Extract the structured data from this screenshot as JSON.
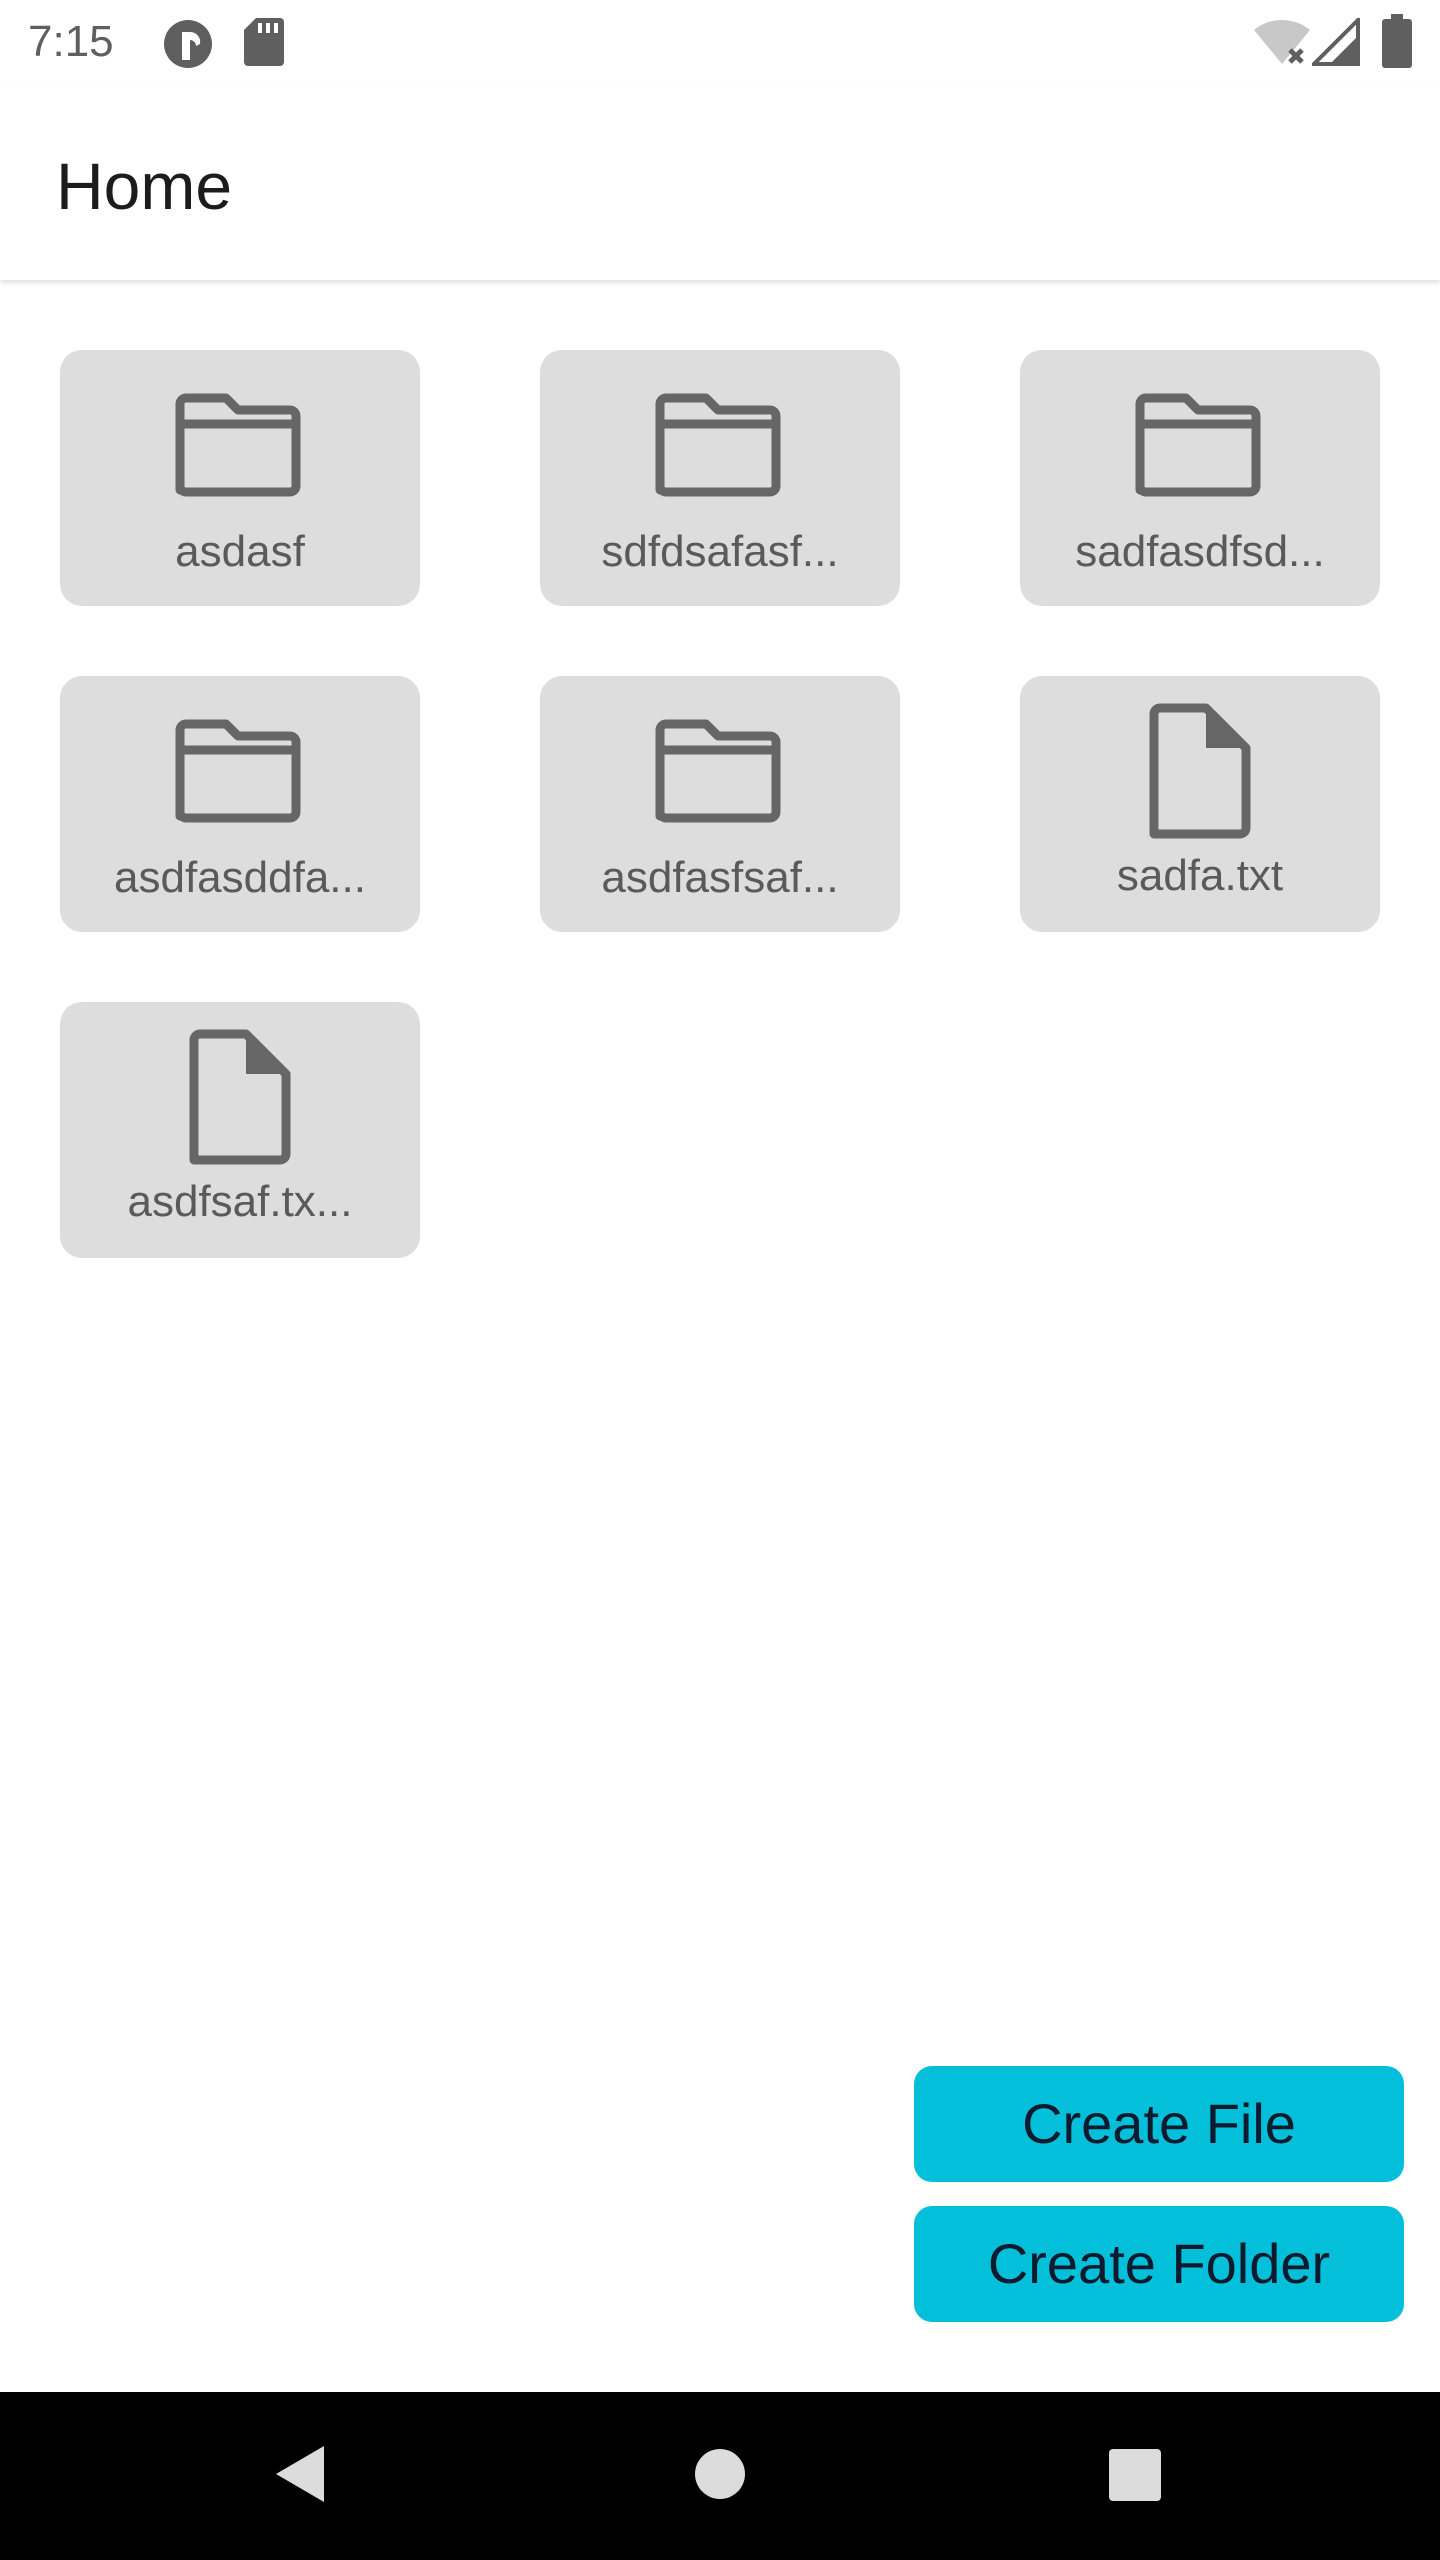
{
  "status_bar": {
    "time": "7:15",
    "icons": [
      "app-notification-icon",
      "sd-card-icon",
      "wifi-off-icon",
      "cell-signal-icon",
      "battery-icon"
    ]
  },
  "app_bar": {
    "title": "Home"
  },
  "items": [
    {
      "type": "folder",
      "icon": "folder-icon",
      "name": "asdasf"
    },
    {
      "type": "folder",
      "icon": "folder-icon",
      "name": "sdfdsafasf..."
    },
    {
      "type": "folder",
      "icon": "folder-icon",
      "name": "sadfasdfsd..."
    },
    {
      "type": "folder",
      "icon": "folder-icon",
      "name": "asdfasddfa..."
    },
    {
      "type": "folder",
      "icon": "folder-icon",
      "name": "asdfasfsaf..."
    },
    {
      "type": "file",
      "icon": "file-icon",
      "name": "sadfa.txt"
    },
    {
      "type": "file",
      "icon": "file-icon",
      "name": "asdfsaf.tx..."
    }
  ],
  "actions": {
    "create_file": "Create File",
    "create_folder": "Create Folder"
  },
  "colors": {
    "accent": "#04bfd9",
    "tile_bg": "#dddddd",
    "icon_gray": "#666666"
  },
  "nav_bar": {
    "icons": [
      "back-icon",
      "home-icon",
      "recents-icon"
    ]
  }
}
